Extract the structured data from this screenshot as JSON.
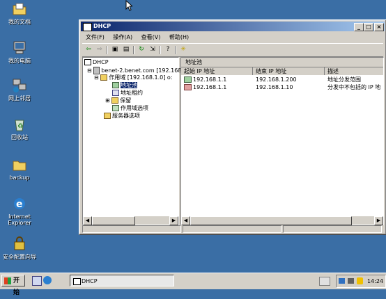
{
  "desktop": {
    "icons": [
      {
        "label": "我的文档",
        "icon": "folder-documents-icon"
      },
      {
        "label": "我的电脑",
        "icon": "computer-icon"
      },
      {
        "label": "网上邻居",
        "icon": "network-icon"
      },
      {
        "label": "回收站",
        "icon": "recycle-bin-icon"
      },
      {
        "label": "backup",
        "icon": "folder-icon"
      },
      {
        "label": "Internet Explorer",
        "icon": "ie-icon"
      },
      {
        "label": "安全配置向导",
        "icon": "security-wizard-icon"
      }
    ]
  },
  "window": {
    "title": "DHCP",
    "menu": [
      "文件(F)",
      "操作(A)",
      "查看(V)",
      "帮助(H)"
    ],
    "tree": {
      "root": "DHCP",
      "server": "benet-2.benet.com [192.168",
      "scope": "作用域 [192.168.1.0] o:",
      "items": [
        "地址池",
        "地址租约",
        "保留",
        "作用域选项"
      ],
      "server_options": "服务器选项"
    },
    "right_title": "地址池",
    "columns": [
      "起始 IP 地址",
      "结束 IP 地址",
      "描述"
    ],
    "rows": [
      {
        "start": "192.168.1.1",
        "end": "192.168.1.200",
        "desc": "地址分发范围"
      },
      {
        "start": "192.168.1.1",
        "end": "192.168.1.10",
        "desc": "分发中不包括的 IP 地"
      }
    ]
  },
  "taskbar": {
    "start_label": "开始",
    "task_label": "DHCP",
    "clock": "14:24"
  }
}
